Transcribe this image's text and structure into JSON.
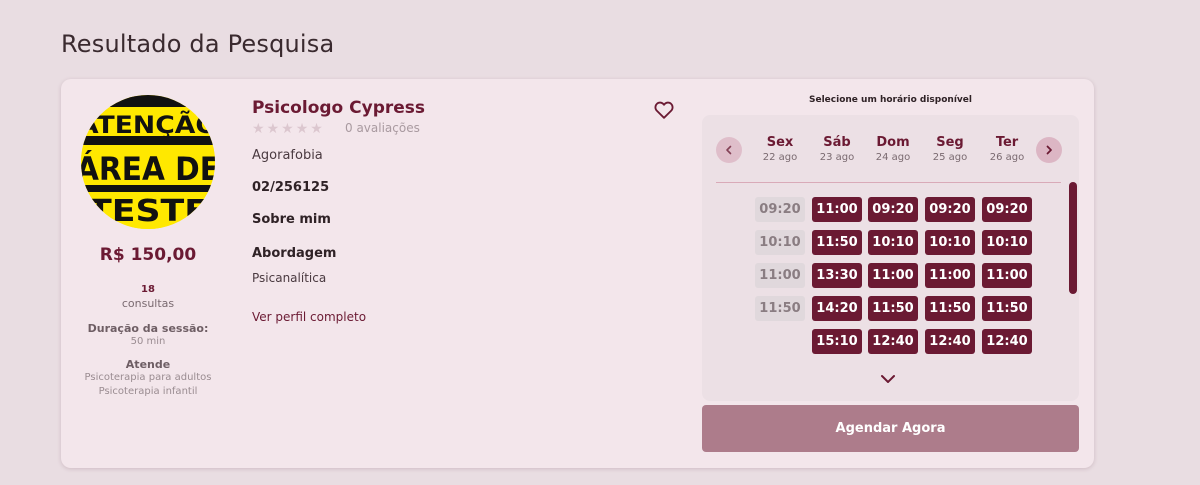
{
  "page": {
    "title": "Resultado da Pesquisa"
  },
  "profile": {
    "avatar_text": [
      "ATENÇÃO",
      "ÁREA DE",
      "TESTE"
    ],
    "price": "R$ 150,00",
    "consultations_count": "18",
    "consultations_label": "consultas",
    "duration_label": "Duração da sessão:",
    "duration_value": "50 min",
    "serves_label": "Atende",
    "serves_items": [
      "Psicoterapia para adultos",
      "Psicoterapia infantil"
    ],
    "name": "Psicologo Cypress",
    "rating_stars": 5,
    "reviews": "0 avaliações",
    "specialty": "Agorafobia",
    "registration": "02/256125",
    "about_label": "Sobre mim",
    "approach_label": "Abordagem",
    "approach_value": "Psicanalítica",
    "profile_link": "Ver perfil completo",
    "favorite_icon": "heart-outline-icon"
  },
  "schedule": {
    "title": "Selecione um horário disponível",
    "days": [
      {
        "name": "Sex",
        "date": "22 ago",
        "slots": [
          {
            "time": "09:20",
            "available": false
          },
          {
            "time": "10:10",
            "available": false
          },
          {
            "time": "11:00",
            "available": false
          },
          {
            "time": "11:50",
            "available": false
          }
        ]
      },
      {
        "name": "Sáb",
        "date": "23 ago",
        "slots": [
          {
            "time": "11:00",
            "available": true
          },
          {
            "time": "11:50",
            "available": true
          },
          {
            "time": "13:30",
            "available": true
          },
          {
            "time": "14:20",
            "available": true
          },
          {
            "time": "15:10",
            "available": true
          }
        ]
      },
      {
        "name": "Dom",
        "date": "24 ago",
        "slots": [
          {
            "time": "09:20",
            "available": true
          },
          {
            "time": "10:10",
            "available": true
          },
          {
            "time": "11:00",
            "available": true
          },
          {
            "time": "11:50",
            "available": true
          },
          {
            "time": "12:40",
            "available": true
          }
        ]
      },
      {
        "name": "Seg",
        "date": "25 ago",
        "slots": [
          {
            "time": "09:20",
            "available": true
          },
          {
            "time": "10:10",
            "available": true
          },
          {
            "time": "11:00",
            "available": true
          },
          {
            "time": "11:50",
            "available": true
          },
          {
            "time": "12:40",
            "available": true
          }
        ]
      },
      {
        "name": "Ter",
        "date": "26 ago",
        "slots": [
          {
            "time": "09:20",
            "available": true
          },
          {
            "time": "10:10",
            "available": true
          },
          {
            "time": "11:00",
            "available": true
          },
          {
            "time": "11:50",
            "available": true
          },
          {
            "time": "12:40",
            "available": true
          }
        ]
      }
    ],
    "book_button": "Agendar Agora"
  },
  "colors": {
    "brand": "#6b1a33",
    "accent_light": "#dcb6c4",
    "book_button": "#ad7c8b",
    "background": "#e9dde2",
    "card": "#f3e6eb"
  }
}
